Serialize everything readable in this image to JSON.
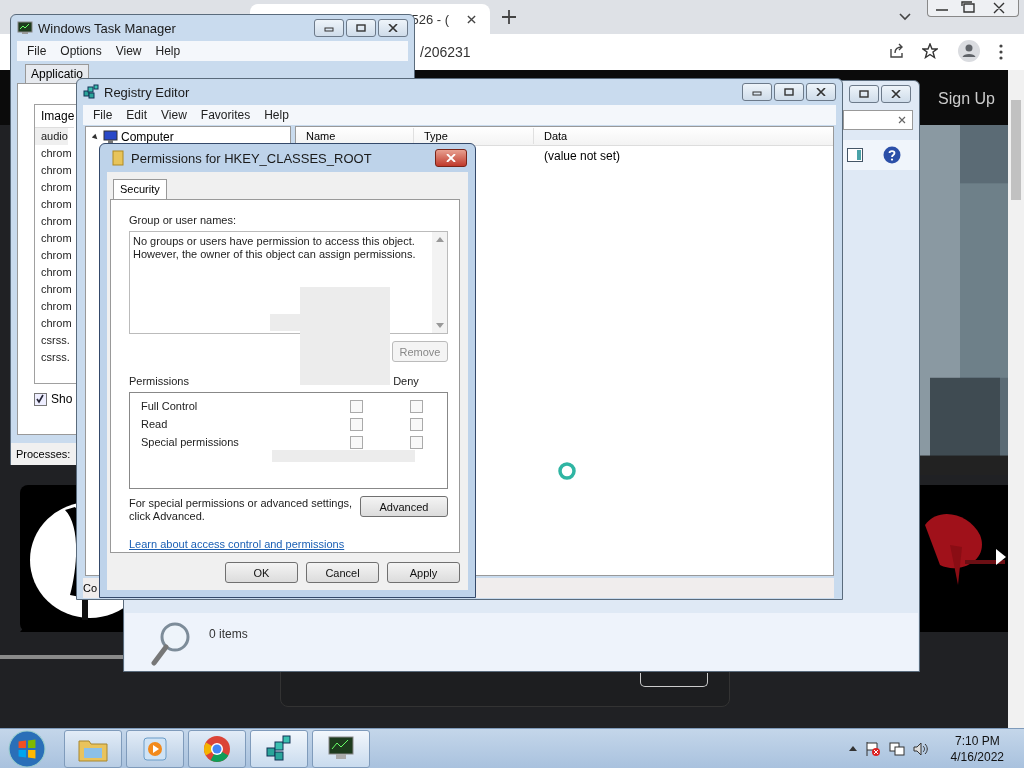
{
  "browser": {
    "tab_title": "526 - (",
    "url": "/206231",
    "sign_up": "Sign Up"
  },
  "search_window": {
    "status": "0 items"
  },
  "task_manager": {
    "title": "Windows Task Manager",
    "menu": [
      "File",
      "Options",
      "View",
      "Help"
    ],
    "tabs": [
      {
        "label": "Applicatio",
        "selected": false
      }
    ],
    "column": "Image",
    "rows": [
      "audio",
      "chrom",
      "chrom",
      "chrom",
      "chrom",
      "chrom",
      "chrom",
      "chrom",
      "chrom",
      "chrom",
      "chrom",
      "chrom",
      "csrss.",
      "csrss."
    ],
    "show_all": {
      "label": "Sho",
      "checked": true
    },
    "status": "Processes:"
  },
  "registry_editor": {
    "title": "Registry Editor",
    "menu": [
      "File",
      "Edit",
      "View",
      "Favorites",
      "Help"
    ],
    "tree": [
      {
        "label": "Computer",
        "expanded": true
      }
    ],
    "columns": [
      "Name",
      "Type",
      "Data"
    ],
    "rows": [
      {
        "data": "(value not set)"
      }
    ],
    "status": "Co"
  },
  "permissions": {
    "title": "Permissions for HKEY_CLASSES_ROOT",
    "tabs": [
      {
        "label": "Security",
        "selected": true
      }
    ],
    "group_label": "Group or user names:",
    "message": "No groups or users have permission to access this object.\nHowever, the owner of this object can assign permissions.",
    "remove_button": {
      "label": "Remove",
      "disabled": true
    },
    "permissions_label": "Permissions",
    "deny_label": "Deny",
    "rows": [
      {
        "name": "Full Control",
        "allow": false,
        "deny": false
      },
      {
        "name": "Read",
        "allow": false,
        "deny": false
      },
      {
        "name": "Special permissions",
        "allow": false,
        "deny": false
      }
    ],
    "advanced_note": "For special permissions or advanced settings,\nclick Advanced.",
    "advanced_button": "Advanced",
    "link": "Learn about access control and permissions",
    "buttons": [
      "OK",
      "Cancel",
      "Apply"
    ]
  },
  "taskbar": {
    "time": "7:10 PM",
    "date": "4/16/2022"
  }
}
